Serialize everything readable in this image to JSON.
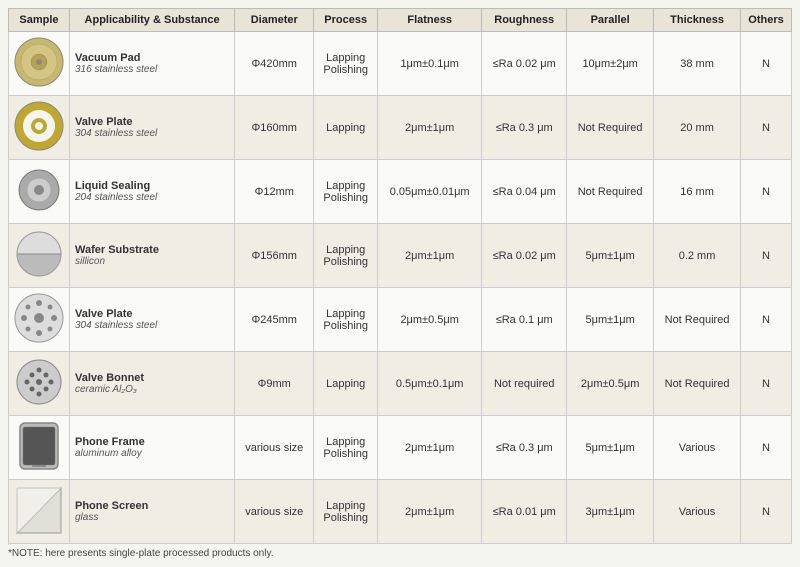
{
  "table": {
    "headers": [
      "Sample",
      "Applicability & Substance",
      "Diameter",
      "Process",
      "Flatness",
      "Roughness",
      "Parallel",
      "Thickness",
      "Others"
    ],
    "rows": [
      {
        "id": 1,
        "sample_type": "circle_metal",
        "name": "Vacuum Pad",
        "substance": "316 stainless steel",
        "diameter": "Φ420mm",
        "process": "Lapping\nPolishing",
        "flatness": "1μm±0.1μm",
        "roughness": "≤Ra 0.02 μm",
        "parallel": "10μm±2μm",
        "thickness": "38 mm",
        "others": "N"
      },
      {
        "id": 2,
        "sample_type": "ring_metal",
        "name": "Valve Plate",
        "substance": "304 stainless steel",
        "diameter": "Φ160mm",
        "process": "Lapping",
        "flatness": "2μm±1μm",
        "roughness": "≤Ra 0.3 μm",
        "parallel": "Not Required",
        "thickness": "20 mm",
        "others": "N"
      },
      {
        "id": 3,
        "sample_type": "small_circle",
        "name": "Liquid Sealing",
        "substance": "204 stainless steel",
        "diameter": "Φ12mm",
        "process": "Lapping\nPolishing",
        "flatness": "0.05μm±0.01μm",
        "roughness": "≤Ra 0.04 μm",
        "parallel": "Not Required",
        "thickness": "16 mm",
        "others": "N"
      },
      {
        "id": 4,
        "sample_type": "half_circle",
        "name": "Wafer Substrate",
        "substance": "sillicon",
        "diameter": "Φ156mm",
        "process": "Lapping\nPolishing",
        "flatness": "2μm±1μm",
        "roughness": "≤Ra 0.02 μm",
        "parallel": "5μm±1μm",
        "thickness": "0.2 mm",
        "others": "N"
      },
      {
        "id": 5,
        "sample_type": "holed_plate",
        "name": "Valve Plate",
        "substance": "304 stainless steel",
        "diameter": "Φ245mm",
        "process": "Lapping\nPolishing",
        "flatness": "2μm±0.5μm",
        "roughness": "≤Ra 0.1 μm",
        "parallel": "5μm±1μm",
        "thickness": "Not Required",
        "others": "N"
      },
      {
        "id": 6,
        "sample_type": "dotted_circle",
        "name": "Valve Bonnet",
        "substance": "ceramic Al₂O₃",
        "diameter": "Φ9mm",
        "process": "Lapping",
        "flatness": "0.5μm±0.1μm",
        "roughness": "Not required",
        "parallel": "2μm±0.5μm",
        "thickness": "Not Required",
        "others": "N"
      },
      {
        "id": 7,
        "sample_type": "phone_frame",
        "name": "Phone Frame",
        "substance": "aluminum alloy",
        "diameter": "various size",
        "process": "Lapping\nPolishing",
        "flatness": "2μm±1μm",
        "roughness": "≤Ra 0.3 μm",
        "parallel": "5μm±1μm",
        "thickness": "Various",
        "others": "N"
      },
      {
        "id": 8,
        "sample_type": "phone_screen",
        "name": "Phone Screen",
        "substance": "glass",
        "diameter": "various size",
        "process": "Lapping\nPolishing",
        "flatness": "2μm±1μm",
        "roughness": "≤Ra 0.01 μm",
        "parallel": "3μm±1μm",
        "thickness": "Various",
        "others": "N"
      }
    ],
    "note": "*NOTE: here presents single-plate processed products only."
  }
}
